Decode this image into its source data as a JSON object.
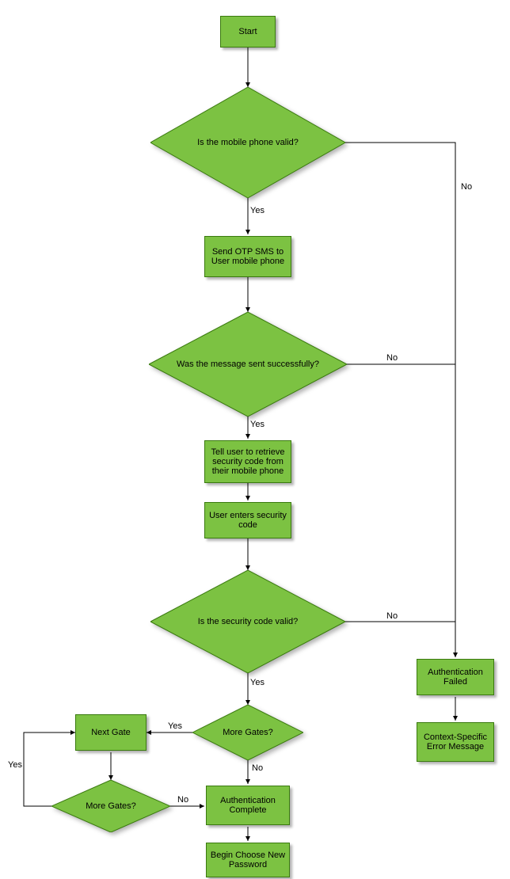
{
  "nodes": {
    "start": "Start",
    "phone_valid": "Is the mobile phone valid?",
    "send_otp": "Send OTP SMS to User mobile phone",
    "msg_sent": "Was the message sent successfully?",
    "tell_user": "Tell user to retrieve security code from their mobile phone",
    "user_enters": "User enters security code",
    "code_valid": "Is the security code valid?",
    "more_gates_top": "More Gates?",
    "next_gate": "Next Gate",
    "more_gates_bottom": "More Gates?",
    "auth_complete": "Authentication Complete",
    "begin_choose": "Begin Choose New Password",
    "auth_failed": "Authentication Failed",
    "error_msg": "Context-Specific Error Message"
  },
  "edges": {
    "yes": "Yes",
    "no": "No"
  },
  "colors": {
    "fill": "#7cc242",
    "stroke": "#3a7a0f"
  }
}
